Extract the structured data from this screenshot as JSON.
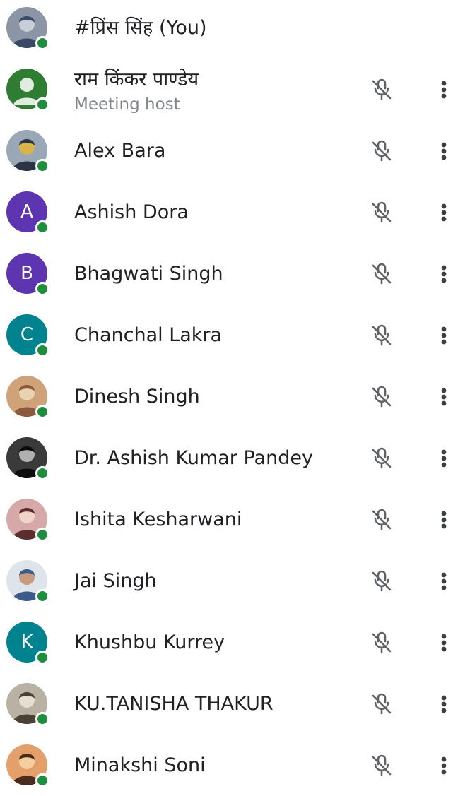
{
  "participants": [
    {
      "name": "#प्रिंस सिंह (You)",
      "subtitle": "",
      "avatar": {
        "kind": "photo",
        "colors": [
          "#8b95a6",
          "#3b4a64",
          "#c8ced8"
        ]
      },
      "online": true,
      "mic_muted": false,
      "mic_icon": "",
      "more_icon": ""
    },
    {
      "name": "राम किंकर पाण्डेय",
      "subtitle": "Meeting host",
      "avatar": {
        "kind": "generic",
        "color": "#2e7d32"
      },
      "online": true,
      "mic_muted": true,
      "mic_icon": "mic-off-icon",
      "more_icon": "more-vert-icon"
    },
    {
      "name": "Alex Bara",
      "subtitle": "",
      "avatar": {
        "kind": "photo",
        "colors": [
          "#9aa7b6",
          "#2b3345",
          "#d8b44a"
        ]
      },
      "online": true,
      "mic_muted": true,
      "mic_icon": "mic-off-icon",
      "more_icon": "more-vert-icon"
    },
    {
      "name": "Ashish Dora",
      "subtitle": "",
      "avatar": {
        "kind": "letter",
        "letter": "A",
        "color": "#5e35b1"
      },
      "online": true,
      "mic_muted": true,
      "mic_icon": "mic-off-icon",
      "more_icon": "more-vert-icon"
    },
    {
      "name": "Bhagwati Singh",
      "subtitle": "",
      "avatar": {
        "kind": "letter",
        "letter": "B",
        "color": "#5e35b1"
      },
      "online": true,
      "mic_muted": true,
      "mic_icon": "mic-off-icon",
      "more_icon": "more-vert-icon"
    },
    {
      "name": "Chanchal Lakra",
      "subtitle": "",
      "avatar": {
        "kind": "letter",
        "letter": "C",
        "color": "#00838f"
      },
      "online": true,
      "mic_muted": true,
      "mic_icon": "mic-off-icon",
      "more_icon": "more-vert-icon"
    },
    {
      "name": "Dinesh Singh",
      "subtitle": "",
      "avatar": {
        "kind": "photo",
        "colors": [
          "#cfa27a",
          "#8b5a3c",
          "#e8d2b0"
        ]
      },
      "online": true,
      "mic_muted": true,
      "mic_icon": "mic-off-icon",
      "more_icon": "more-vert-icon"
    },
    {
      "name": "Dr. Ashish Kumar Pandey",
      "subtitle": "",
      "avatar": {
        "kind": "photo",
        "colors": [
          "#3a3a3a",
          "#0d0d0d",
          "#b0b0b0"
        ]
      },
      "online": true,
      "mic_muted": true,
      "mic_icon": "mic-off-icon",
      "more_icon": "more-vert-icon"
    },
    {
      "name": "Ishita Kesharwani",
      "subtitle": "",
      "avatar": {
        "kind": "photo",
        "colors": [
          "#d7a8a8",
          "#5a2e2e",
          "#f0d4c8"
        ]
      },
      "online": true,
      "mic_muted": true,
      "mic_icon": "mic-off-icon",
      "more_icon": "more-vert-icon"
    },
    {
      "name": "Jai Singh",
      "subtitle": "",
      "avatar": {
        "kind": "photo",
        "colors": [
          "#dfe4ea",
          "#3c5a8a",
          "#c79b7e"
        ]
      },
      "online": true,
      "mic_muted": true,
      "mic_icon": "mic-off-icon",
      "more_icon": "more-vert-icon"
    },
    {
      "name": "Khushbu Kurrey",
      "subtitle": "",
      "avatar": {
        "kind": "letter",
        "letter": "K",
        "color": "#00838f"
      },
      "online": true,
      "mic_muted": true,
      "mic_icon": "mic-off-icon",
      "more_icon": "more-vert-icon"
    },
    {
      "name": "KU.TANISHA THAKUR",
      "subtitle": "",
      "avatar": {
        "kind": "photo",
        "colors": [
          "#b9b2a4",
          "#4a4035",
          "#e6dfcf"
        ]
      },
      "online": true,
      "mic_muted": true,
      "mic_icon": "mic-off-icon",
      "more_icon": "more-vert-icon"
    },
    {
      "name": "Minakshi Soni",
      "subtitle": "",
      "avatar": {
        "kind": "photo",
        "colors": [
          "#e3a06a",
          "#4a2c1c",
          "#f3cfa0"
        ]
      },
      "online": true,
      "mic_muted": true,
      "mic_icon": "mic-off-icon",
      "more_icon": "more-vert-icon"
    }
  ],
  "colors": {
    "online_dot": "#1e8e3e",
    "icon_gray": "#5f6368",
    "text_primary": "#202124",
    "text_secondary": "#80868b"
  }
}
